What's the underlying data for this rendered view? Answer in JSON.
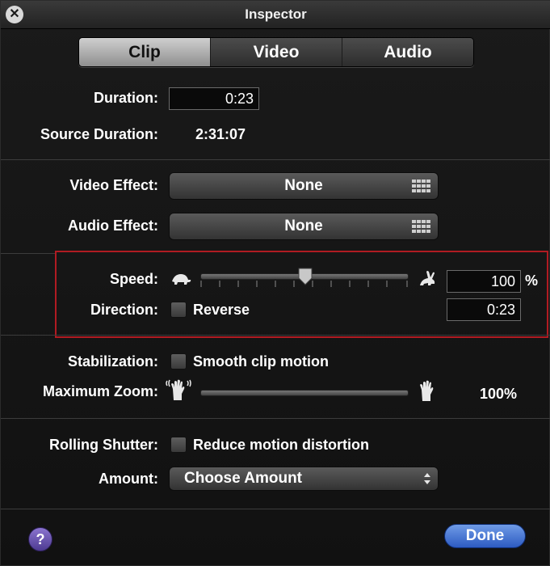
{
  "window": {
    "title": "Inspector"
  },
  "tabs": [
    {
      "label": "Clip",
      "active": true
    },
    {
      "label": "Video",
      "active": false
    },
    {
      "label": "Audio",
      "active": false
    }
  ],
  "clip": {
    "duration_label": "Duration:",
    "duration_value": "0:23",
    "source_duration_label": "Source Duration:",
    "source_duration_value": "2:31:07"
  },
  "effects": {
    "video_label": "Video Effect:",
    "video_value": "None",
    "audio_label": "Audio Effect:",
    "audio_value": "None"
  },
  "speed": {
    "label": "Speed:",
    "value": "100",
    "unit": "%",
    "slider_fraction": 0.5,
    "direction_label": "Direction:",
    "reverse_label": "Reverse",
    "reverse_checked": false,
    "result_duration": "0:23"
  },
  "stabilization": {
    "label": "Stabilization:",
    "checkbox_label": "Smooth clip motion",
    "checked": false,
    "max_zoom_label": "Maximum Zoom:",
    "max_zoom_value": "100%",
    "max_zoom_fraction": 1.0
  },
  "rolling_shutter": {
    "label": "Rolling Shutter:",
    "checkbox_label": "Reduce motion distortion",
    "checked": false,
    "amount_label": "Amount:",
    "amount_value": "Choose Amount"
  },
  "footer": {
    "help_label": "?",
    "done_label": "Done"
  },
  "colors": {
    "highlight": "#b01b22",
    "done_button": "#2d5bc2",
    "help_button": "#5b46a6"
  },
  "icons": [
    "close-icon",
    "grid-icon",
    "turtle-icon",
    "rabbit-icon",
    "hand-shake-icon",
    "hand-icon",
    "up-down-arrows-icon"
  ]
}
